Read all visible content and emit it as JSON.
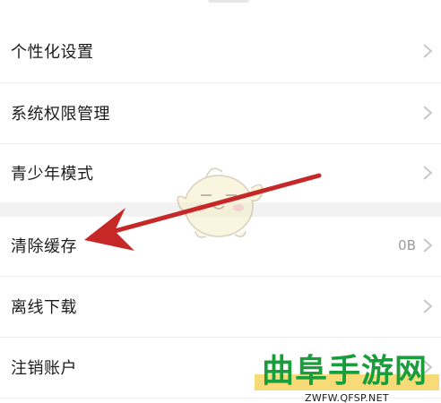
{
  "settings": {
    "group1": [
      {
        "label": "个性化设置",
        "value": ""
      },
      {
        "label": "系统权限管理",
        "value": ""
      },
      {
        "label": "青少年模式",
        "value": ""
      }
    ],
    "group2": [
      {
        "label": "清除缓存",
        "value": "0B"
      },
      {
        "label": "离线下载",
        "value": ""
      },
      {
        "label": "注销账户",
        "value": ""
      }
    ]
  },
  "annotation": {
    "arrow_color": "#c62828",
    "target": "清除缓存"
  },
  "watermark": {
    "title": "曲阜手游网",
    "url": "ZWFW.QFSP.NET",
    "title_color": "#1a9e3c",
    "band_color": "#f6d560"
  },
  "colors": {
    "background": "#ffffff",
    "section_gap": "#f2f2f2",
    "label": "#1c1c1c",
    "value": "#9a9a9a"
  }
}
